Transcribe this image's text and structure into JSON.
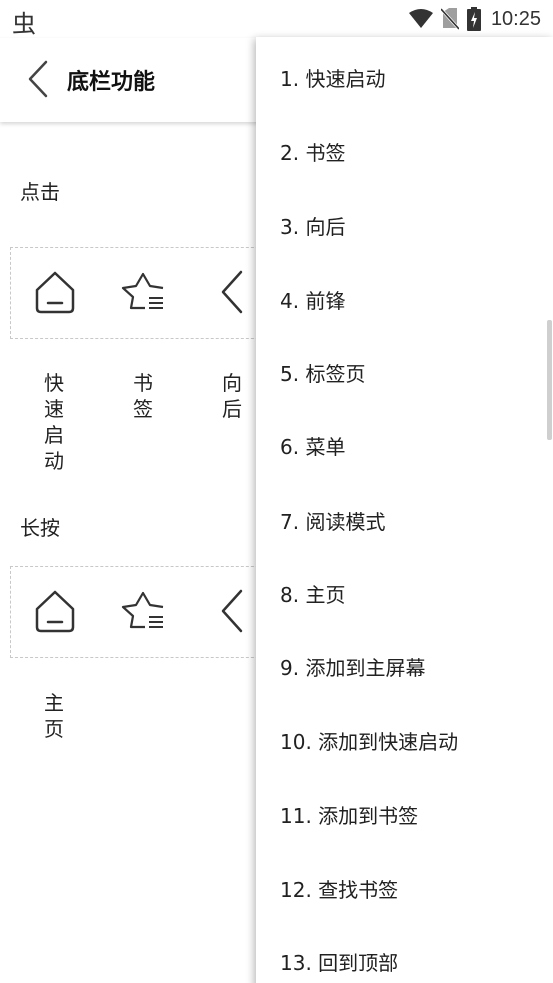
{
  "status_bar": {
    "app_glyph": "虫",
    "time": "10:25"
  },
  "header": {
    "title": "底栏功能"
  },
  "click_section": {
    "label": "点击",
    "items": [
      {
        "icon": "home-icon",
        "label": "快速启动"
      },
      {
        "icon": "bookmark-star-icon",
        "label": "书签"
      },
      {
        "icon": "back-arrow-icon",
        "label": "向后"
      }
    ]
  },
  "long_press_section": {
    "label": "长按",
    "items": [
      {
        "icon": "home-icon",
        "label": "主页"
      },
      {
        "icon": "bookmark-star-icon",
        "label": ""
      },
      {
        "icon": "back-arrow-icon",
        "label": ""
      }
    ]
  },
  "menu": {
    "items": [
      "1. 快速启动",
      "2. 书签",
      "3. 向后",
      "4. 前锋",
      "5. 标签页",
      "6. 菜单",
      "7. 阅读模式",
      "8. 主页",
      "9. 添加到主屏幕",
      "10. 添加到快速启动",
      "11. 添加到书签",
      "12. 查找书签",
      "13. 回到顶部"
    ]
  }
}
